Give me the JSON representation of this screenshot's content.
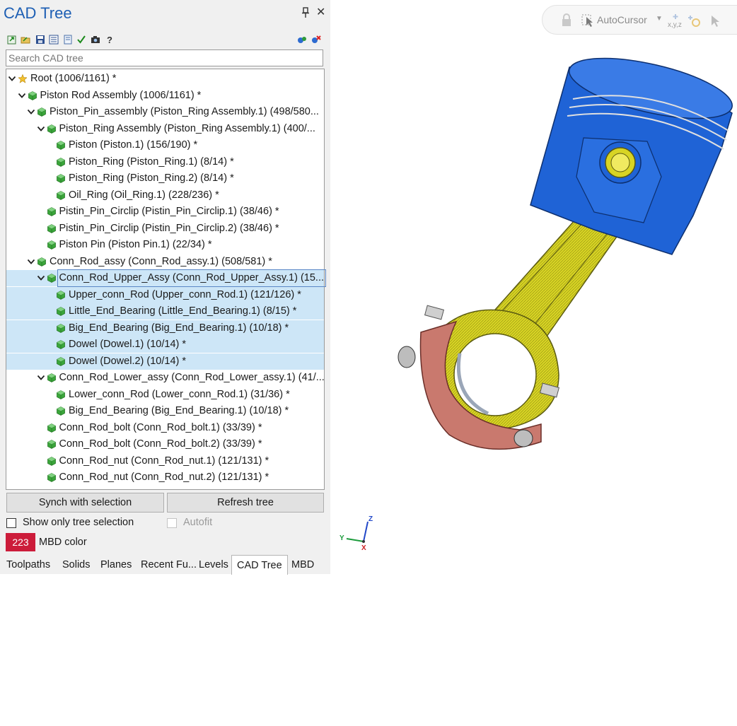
{
  "panel": {
    "title": "CAD Tree",
    "search_placeholder": "Search CAD tree"
  },
  "tree": [
    {
      "label": "Root (1006/1161) *",
      "level": 0,
      "icon": "star-icon",
      "expanded": true,
      "selected": false
    },
    {
      "label": "Piston Rod Assembly (1006/1161) *",
      "level": 1,
      "icon": "part-icon",
      "expanded": true,
      "selected": false
    },
    {
      "label": "Piston_Pin_assembly (Piston_Ring Assembly.1) (498/580...",
      "level": 2,
      "icon": "part-icon",
      "expanded": true,
      "selected": false
    },
    {
      "label": "Piston_Ring Assembly (Piston_Ring Assembly.1) (400/...",
      "level": 3,
      "icon": "part-icon",
      "expanded": true,
      "selected": false
    },
    {
      "label": "Piston (Piston.1) (156/190) *",
      "level": 4,
      "icon": "part-icon",
      "expanded": null,
      "selected": false
    },
    {
      "label": "Piston_Ring (Piston_Ring.1) (8/14) *",
      "level": 4,
      "icon": "part-icon",
      "expanded": null,
      "selected": false
    },
    {
      "label": "Piston_Ring (Piston_Ring.2) (8/14) *",
      "level": 4,
      "icon": "part-icon",
      "expanded": null,
      "selected": false
    },
    {
      "label": "Oil_Ring (Oil_Ring.1) (228/236) *",
      "level": 4,
      "icon": "part-icon",
      "expanded": null,
      "selected": false
    },
    {
      "label": "Pistin_Pin_Circlip (Pistin_Pin_Circlip.1) (38/46) *",
      "level": 3,
      "icon": "part-icon",
      "expanded": null,
      "selected": false
    },
    {
      "label": "Pistin_Pin_Circlip (Pistin_Pin_Circlip.2) (38/46) *",
      "level": 3,
      "icon": "part-icon",
      "expanded": null,
      "selected": false
    },
    {
      "label": "Piston Pin (Piston Pin.1) (22/34) *",
      "level": 3,
      "icon": "part-icon",
      "expanded": null,
      "selected": false
    },
    {
      "label": "Conn_Rod_assy (Conn_Rod_assy.1) (508/581) *",
      "level": 2,
      "icon": "part-icon",
      "expanded": true,
      "selected": false
    },
    {
      "label": "Conn_Rod_Upper_Assy (Conn_Rod_Upper_Assy.1) (15...",
      "level": 3,
      "icon": "part-icon",
      "expanded": true,
      "selected": true,
      "focus": true
    },
    {
      "label": "Upper_conn_Rod (Upper_conn_Rod.1) (121/126) *",
      "level": 4,
      "icon": "part-icon",
      "expanded": null,
      "selected": true
    },
    {
      "label": "Little_End_Bearing (Little_End_Bearing.1) (8/15) *",
      "level": 4,
      "icon": "part-icon",
      "expanded": null,
      "selected": true
    },
    {
      "label": "Big_End_Bearing (Big_End_Bearing.1) (10/18) *",
      "level": 4,
      "icon": "part-icon",
      "expanded": null,
      "selected": true
    },
    {
      "label": "Dowel (Dowel.1) (10/14) *",
      "level": 4,
      "icon": "part-icon",
      "expanded": null,
      "selected": true
    },
    {
      "label": "Dowel (Dowel.2) (10/14) *",
      "level": 4,
      "icon": "part-icon",
      "expanded": null,
      "selected": true
    },
    {
      "label": "Conn_Rod_Lower_assy (Conn_Rod_Lower_assy.1) (41/...",
      "level": 3,
      "icon": "part-icon",
      "expanded": true,
      "selected": false
    },
    {
      "label": "Lower_conn_Rod (Lower_conn_Rod.1) (31/36) *",
      "level": 4,
      "icon": "part-icon",
      "expanded": null,
      "selected": false
    },
    {
      "label": "Big_End_Bearing (Big_End_Bearing.1) (10/18) *",
      "level": 4,
      "icon": "part-icon",
      "expanded": null,
      "selected": false
    },
    {
      "label": "Conn_Rod_bolt (Conn_Rod_bolt.1) (33/39) *",
      "level": 3,
      "icon": "part-icon",
      "expanded": null,
      "selected": false
    },
    {
      "label": "Conn_Rod_bolt (Conn_Rod_bolt.2) (33/39) *",
      "level": 3,
      "icon": "part-icon",
      "expanded": null,
      "selected": false
    },
    {
      "label": "Conn_Rod_nut (Conn_Rod_nut.1) (121/131) *",
      "level": 3,
      "icon": "part-icon",
      "expanded": null,
      "selected": false
    },
    {
      "label": "Conn_Rod_nut (Conn_Rod_nut.2) (121/131) *",
      "level": 3,
      "icon": "part-icon",
      "expanded": null,
      "selected": false
    }
  ],
  "buttons": {
    "synch": "Synch with selection",
    "refresh": "Refresh tree"
  },
  "options": {
    "show_only_tree_selection": "Show only tree selection",
    "autofit": "Autofit",
    "mbd_value": "223",
    "mbd_label": "MBD color",
    "mbd_color": "#cc1c3a"
  },
  "tabs": [
    {
      "label": "Toolpaths",
      "active": false
    },
    {
      "label": "Solids",
      "active": false
    },
    {
      "label": "Planes",
      "active": false
    },
    {
      "label": "Recent Fu...",
      "active": false
    },
    {
      "label": "Levels",
      "active": false
    },
    {
      "label": "CAD Tree",
      "active": true
    },
    {
      "label": "MBD",
      "active": false
    }
  ],
  "viewport": {
    "autocursor_label": "AutoCursor",
    "axis_labels": {
      "z": "Z",
      "y": "Y",
      "x": "X"
    }
  },
  "colors": {
    "accent": "#1e5fb4",
    "selection": "#cde6f7",
    "piston": "#1f63d6",
    "rod": "#d8d424",
    "cap": "#c9796e",
    "cube": "#3aa53a"
  }
}
